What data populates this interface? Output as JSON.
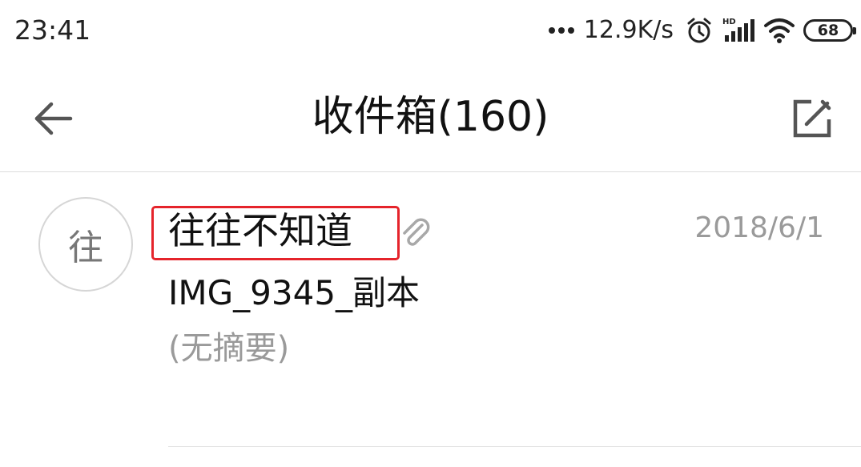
{
  "status_bar": {
    "time": "23:41",
    "network_speed": "12.9K/s",
    "battery_level": "68",
    "icons": [
      "more-dots-icon",
      "alarm-icon",
      "hd-signal-icon",
      "wifi-icon",
      "battery-icon"
    ]
  },
  "header": {
    "title": "收件箱(160)",
    "back_icon": "arrow-left-icon",
    "compose_icon": "compose-icon"
  },
  "messages": [
    {
      "avatar_text": "往",
      "sender": "往往不知道",
      "has_attachment": true,
      "date": "2018/6/1",
      "subject": "IMG_9345_副本",
      "preview": "(无摘要)"
    }
  ],
  "colors": {
    "highlight_box": "#e5242b",
    "secondary_text": "#9a9a9a",
    "icon_gray": "#555555"
  }
}
